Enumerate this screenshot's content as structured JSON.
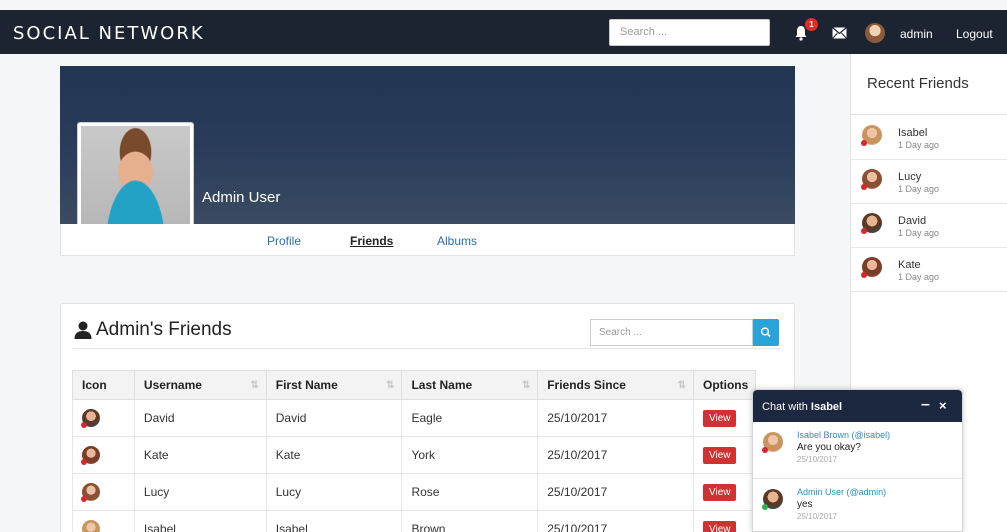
{
  "navbar": {
    "brand": "SOCIAL NETWORK",
    "search_placeholder": "Search ...",
    "notification_count": "1",
    "username": "admin",
    "logout_label": "Logout"
  },
  "profile": {
    "name": "Admin User",
    "tabs": [
      {
        "label": "Profile",
        "active": false
      },
      {
        "label": "Friends",
        "active": true
      },
      {
        "label": "Albums",
        "active": false
      }
    ]
  },
  "friends_panel": {
    "title": "Admin's Friends",
    "search_placeholder": "Search ...",
    "columns": [
      "Icon",
      "Username",
      "First Name",
      "Last Name",
      "Friends Since",
      "Options"
    ],
    "rows": [
      {
        "username": "David",
        "first_name": "David",
        "last_name": "Eagle",
        "since": "25/10/2017",
        "action": "View"
      },
      {
        "username": "Kate",
        "first_name": "Kate",
        "last_name": "York",
        "since": "25/10/2017",
        "action": "View"
      },
      {
        "username": "Lucy",
        "first_name": "Lucy",
        "last_name": "Rose",
        "since": "25/10/2017",
        "action": "View"
      },
      {
        "username": "Isabel",
        "first_name": "Isabel",
        "last_name": "Brown",
        "since": "25/10/2017",
        "action": "View"
      }
    ]
  },
  "recent_friends": {
    "title": "Recent Friends",
    "items": [
      {
        "name": "Isabel",
        "time": "1 Day ago"
      },
      {
        "name": "Lucy",
        "time": "1 Day ago"
      },
      {
        "name": "David",
        "time": "1 Day ago"
      },
      {
        "name": "Kate",
        "time": "1 Day ago"
      }
    ]
  },
  "chat": {
    "title_prefix": "Chat with",
    "title_name": "Isabel",
    "minimize_label": "–",
    "close_label": "×",
    "messages": [
      {
        "author": "Isabel Brown (@isabel)",
        "text": "Are you okay?",
        "time": "25/10/2017"
      },
      {
        "author": "Admin User (@admin)",
        "text": "yes",
        "time": "25/10/2017"
      }
    ]
  },
  "colors": {
    "navbar": "#1c2331",
    "accent": "#2aa3d8",
    "danger": "#d03131",
    "online": "#2fb14a",
    "offline": "#d9262b"
  }
}
